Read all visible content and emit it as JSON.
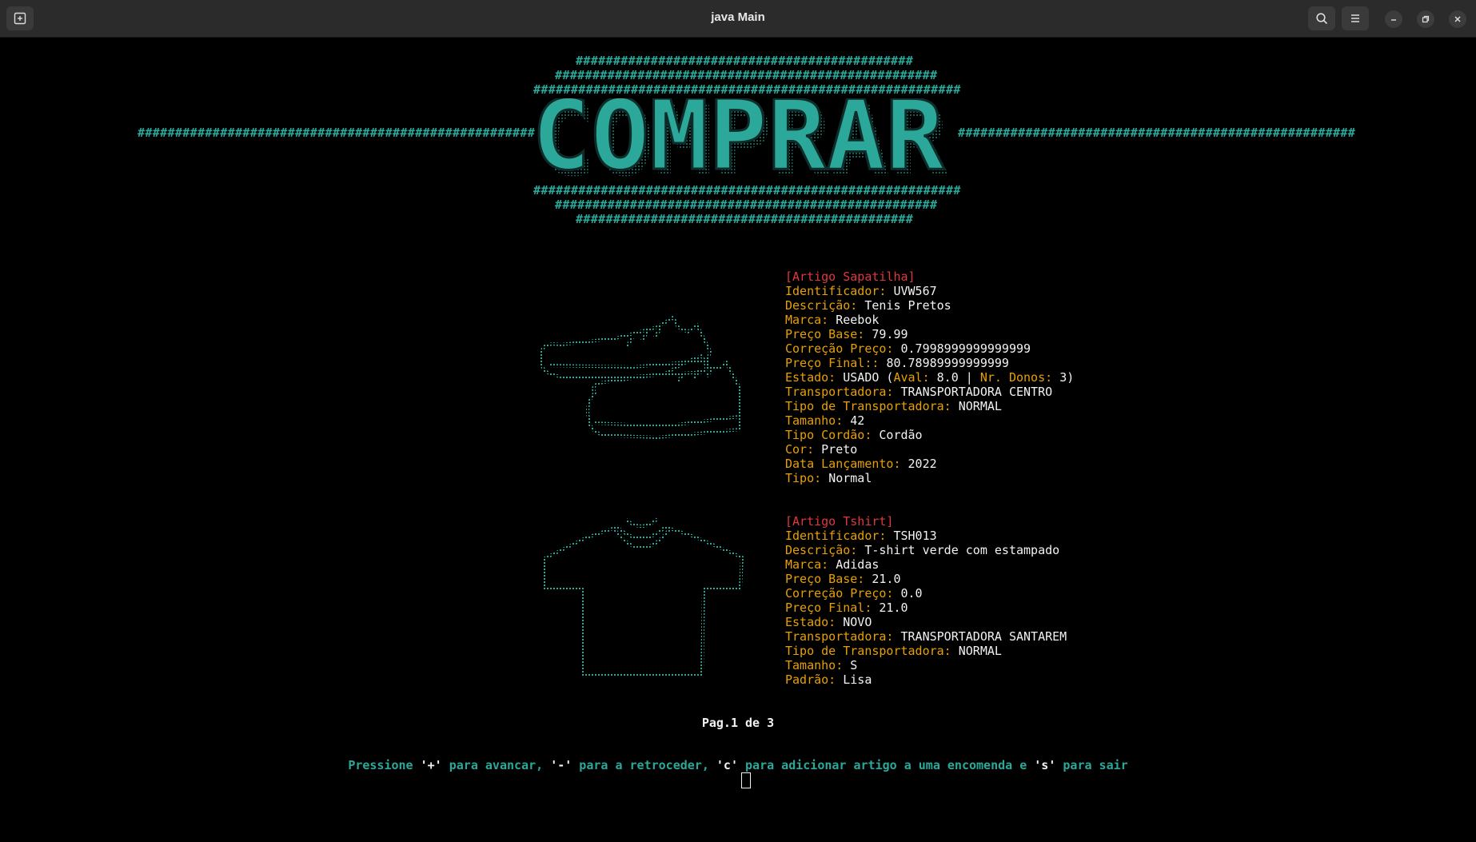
{
  "window": {
    "title": "java Main",
    "icons": [
      "new-tab-icon",
      "search-icon",
      "menu-icon",
      "minimize-icon",
      "maximize-icon",
      "close-icon"
    ]
  },
  "banner": {
    "title": "COMPRAR",
    "hash_row_1": "#############################################",
    "hash_row_2": "###################################################",
    "hash_row_3": "#########################################################",
    "hash_side_left": "#####################################################",
    "hash_side_right": "#####################################################",
    "color": "#2ca89a"
  },
  "items": [
    {
      "header": "[Artigo Sapatilha]",
      "icon": "sneaker-icon",
      "fields": [
        {
          "label": "Identificador:",
          "value": "UVW567"
        },
        {
          "label": "Descrição:",
          "value": "Tenis Pretos"
        },
        {
          "label": "Marca:",
          "value": "Reebok"
        },
        {
          "label": "Preço Base:",
          "value": "79.99"
        },
        {
          "label": "Correção Preço:",
          "value": "0.7998999999999999"
        },
        {
          "label": "Preço Final::",
          "value": "80.78989999999999"
        },
        {
          "label": "Estado:",
          "value": "USADO (",
          "aval_label": "Aval:",
          "aval_value": "8.0 |",
          "donos_label": "Nr. Donos:",
          "donos_value": "3)"
        },
        {
          "label": "Transportadora:",
          "value": "TRANSPORTADORA CENTRO"
        },
        {
          "label": "Tipo de Transportadora:",
          "value": "NORMAL"
        },
        {
          "label": "Tamanho:",
          "value": "42"
        },
        {
          "label": "Tipo Cordão:",
          "value": "Cordão"
        },
        {
          "label": "Cor:",
          "value": "Preto"
        },
        {
          "label": "Data Lançamento:",
          "value": "2022"
        },
        {
          "label": "Tipo:",
          "value": "Normal"
        }
      ]
    },
    {
      "header": "[Artigo Tshirt]",
      "icon": "tshirt-icon",
      "fields": [
        {
          "label": "Identificador:",
          "value": "TSH013"
        },
        {
          "label": "Descrição:",
          "value": "T-shirt verde com estampado"
        },
        {
          "label": "Marca:",
          "value": "Adidas"
        },
        {
          "label": "Preço Base:",
          "value": "21.0"
        },
        {
          "label": "Correção Preço:",
          "value": "0.0"
        },
        {
          "label": "Preço Final:",
          "value": "21.0"
        },
        {
          "label": "Estado:",
          "value": "NOVO"
        },
        {
          "label": "Transportadora:",
          "value": "TRANSPORTADORA SANTAREM"
        },
        {
          "label": "Tipo de Transportadora:",
          "value": "NORMAL"
        },
        {
          "label": "Tamanho:",
          "value": "S"
        },
        {
          "label": "Padrão:",
          "value": "Lisa"
        }
      ]
    }
  ],
  "pagination": {
    "text": "Pag.1 de 3"
  },
  "prompt": {
    "p1": "Pressione ",
    "k1": "'+'",
    "p2": " para avancar, ",
    "k2": "'-'",
    "p3": " para a retroceder, ",
    "k3": "'c'",
    "p4": " para adicionar artigo a uma encomenda e ",
    "k4": "'s'",
    "p5": " para sair"
  },
  "colors": {
    "accent": "#2ca89a",
    "label": "#e8a000",
    "header": "#e0383e",
    "text": "#f2f2f2"
  }
}
